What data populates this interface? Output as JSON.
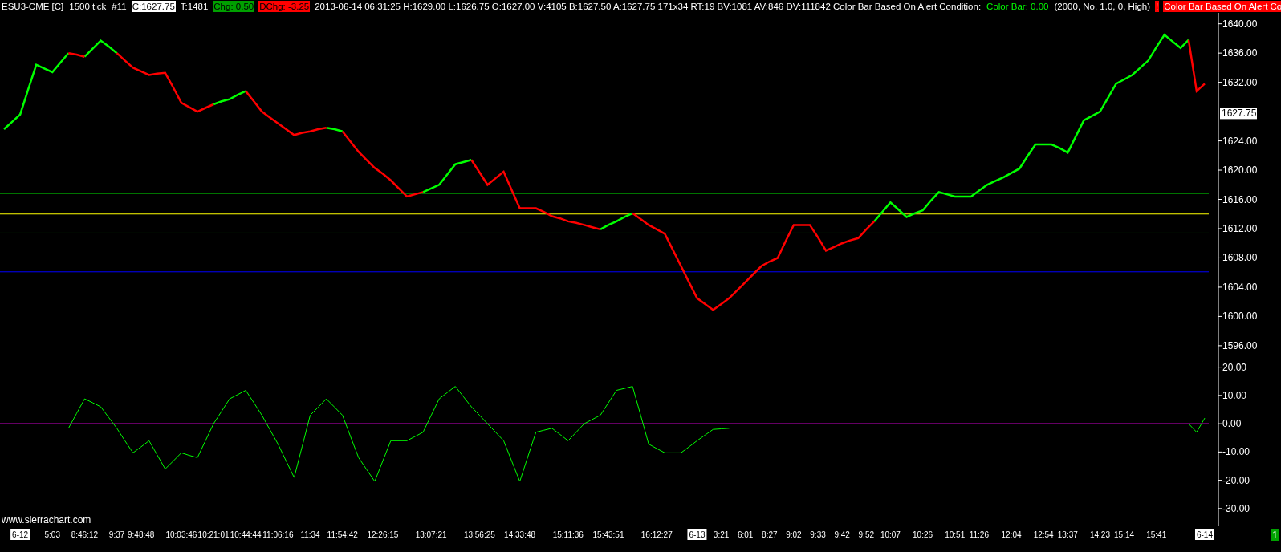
{
  "header": [
    {
      "kind": "plain",
      "text": "ESU3-CME [C]"
    },
    {
      "kind": "plain",
      "text": "1500 tick"
    },
    {
      "kind": "plain",
      "text": "#11"
    },
    {
      "kind": "inverse",
      "text": "C:1627.75"
    },
    {
      "kind": "plain",
      "text": "T:1481"
    },
    {
      "kind": "up",
      "text": "Chg: 0.50"
    },
    {
      "kind": "down",
      "text": "DChg: -3.25"
    },
    {
      "kind": "plain",
      "text": "2013-06-14 06:31:25 H:1629.00 L:1626.75 O:1627.00 V:4105 B:1627.50 A:1627.75 171x34 RT:19 BV:1081 AV:846 DV:111842 Color Bar Based On Alert Condition:"
    },
    {
      "kind": "green",
      "text": "Color Bar: 0.00"
    },
    {
      "kind": "plain",
      "text": "(2000, No, 1.0, 0, High)"
    },
    {
      "kind": "alert",
      "text": "!"
    },
    {
      "kind": "alert",
      "text": "Color Bar Based On Alert Co"
    }
  ],
  "price_chart": {
    "current_price": "1627.75",
    "chart_data": {
      "type": "line",
      "ylim": [
        1595,
        1641.5
      ],
      "categories": [
        null,
        null,
        null,
        null,
        null,
        null,
        null,
        null,
        null,
        null,
        null,
        null,
        null,
        null,
        null,
        null,
        null,
        null,
        null,
        null,
        null,
        null,
        null,
        null,
        null,
        null,
        null,
        null,
        null,
        null,
        null,
        null,
        null,
        null,
        null,
        null,
        null,
        null,
        null,
        null,
        null,
        null,
        null,
        null,
        null,
        null,
        null,
        null,
        null,
        null,
        null,
        null,
        null,
        null,
        null,
        null,
        null,
        null,
        null,
        null,
        null,
        null,
        null,
        null,
        null,
        null,
        null,
        null,
        null,
        null,
        null,
        null,
        null,
        null,
        null,
        null,
        null,
        null,
        null,
        null,
        null,
        null,
        null,
        null,
        null,
        null,
        null,
        null,
        null,
        null,
        null,
        null,
        null,
        null,
        null,
        null,
        null,
        null,
        null,
        null,
        null,
        null,
        null,
        null,
        null,
        null,
        null,
        null,
        null,
        null,
        null,
        null,
        null,
        null,
        null,
        null,
        null,
        null,
        null,
        null,
        null,
        null,
        null,
        null,
        null,
        null,
        null,
        null,
        null,
        null,
        null,
        null,
        null,
        null,
        null,
        null,
        null,
        null,
        null,
        null,
        null,
        null,
        null,
        null,
        null,
        null,
        null,
        null,
        null,
        null
      ],
      "yticks": [
        {
          "value": 1640,
          "label": "1640.00"
        },
        {
          "value": 1636,
          "label": "1636.00"
        },
        {
          "value": 1632,
          "label": "1632.00"
        },
        {
          "value": 1624,
          "label": "1624.00"
        },
        {
          "value": 1620,
          "label": "1620.00"
        },
        {
          "value": 1616,
          "label": "1616.00"
        },
        {
          "value": 1612,
          "label": "1612.00"
        },
        {
          "value": 1608,
          "label": "1608.00"
        },
        {
          "value": 1604,
          "label": "1604.00"
        },
        {
          "value": 1600,
          "label": "1600.00"
        },
        {
          "value": 1596,
          "label": "1596.00"
        }
      ],
      "series": [
        {
          "color": "#00ff00",
          "values": [
            1625.6,
            1626.6,
            1627.6,
            1631,
            1634.4,
            1633.9,
            1633.4,
            1634.7,
            1636,
            null,
            1635.5,
            1636.6,
            1637.7,
            1636.9,
            1636,
            null,
            null,
            null,
            null,
            null,
            null,
            null,
            null,
            null,
            null,
            null,
            1629,
            1629.4,
            1629.7,
            1630.3,
            1630.8,
            null,
            null,
            null,
            null,
            null,
            null,
            null,
            null,
            null,
            1625.8,
            1625.6,
            1625.3,
            null,
            null,
            null,
            null,
            null,
            null,
            null,
            null,
            null,
            1617,
            1617.5,
            1618,
            1619.4,
            1620.8,
            1621.1,
            1621.4,
            null,
            null,
            null,
            null,
            null,
            null,
            null,
            null,
            null,
            null,
            null,
            null,
            null,
            null,
            null,
            1611.9,
            1612.5,
            1613,
            1613.6,
            1614.1,
            null,
            null,
            null,
            null,
            null,
            null,
            null,
            null,
            null,
            null,
            null,
            null,
            null,
            null,
            null,
            null,
            null,
            null,
            null,
            null,
            null,
            null,
            null,
            null,
            null,
            null,
            null,
            null,
            null,
            1613,
            1614.3,
            1615.6,
            1614.6,
            1613.6,
            1614.1,
            1614.5,
            1615.8,
            1617,
            1616.7,
            1616.4,
            1616.4,
            1616.4,
            1617.2,
            1618,
            1618.5,
            1619,
            1619.6,
            1620.2,
            1621.9,
            1623.5,
            1623.5,
            1623.5,
            1623,
            1622.4,
            1624.6,
            1626.8,
            1627.4,
            1628,
            1629.9,
            1631.8,
            1632.4,
            1633,
            1634,
            1635,
            1636.8,
            1638.5,
            1637.6,
            1636.7,
            1637.8,
            null,
            null
          ]
        },
        {
          "color": "#ff0000",
          "values": [
            null,
            null,
            null,
            null,
            null,
            null,
            null,
            null,
            1636,
            1635.8,
            1635.5,
            null,
            null,
            null,
            1636,
            1635,
            1634,
            1633.5,
            1633,
            1633.2,
            1633.3,
            1631.3,
            1629.2,
            1628.6,
            1628,
            1628.5,
            1629,
            null,
            null,
            null,
            1630.8,
            1629.4,
            1628,
            1627.2,
            1626.4,
            1625.6,
            1624.8,
            1625.1,
            1625.3,
            1625.6,
            1625.8,
            null,
            1625.3,
            1623.9,
            1622.5,
            1621.4,
            1620.3,
            1619.5,
            1618.6,
            1617.5,
            1616.4,
            1616.7,
            1617,
            null,
            null,
            null,
            null,
            null,
            1621.4,
            1619.7,
            1618,
            1618.9,
            1619.8,
            1617.3,
            1614.8,
            1614.8,
            1614.8,
            1614.3,
            1613.7,
            1613.4,
            1613,
            1612.8,
            1612.5,
            1612.2,
            1611.9,
            null,
            null,
            null,
            1614.1,
            1613.3,
            1612.5,
            1611.9,
            1611.3,
            1609.1,
            1606.9,
            1604.7,
            1602.5,
            1601.7,
            1600.9,
            1601.7,
            1602.5,
            1603.6,
            1604.7,
            1605.8,
            1606.9,
            1607.5,
            1608,
            1610.3,
            1612.5,
            1612.5,
            1612.5,
            1610.8,
            1609,
            1609.5,
            1610,
            1610.4,
            1610.7,
            1611.9,
            1613,
            null,
            null,
            null,
            null,
            null,
            null,
            null,
            null,
            null,
            null,
            null,
            null,
            null,
            null,
            null,
            null,
            null,
            null,
            null,
            null,
            null,
            null,
            null,
            null,
            null,
            null,
            null,
            null,
            null,
            null,
            null,
            null,
            null,
            null,
            null,
            null,
            null,
            null,
            1637.8,
            1630.8,
            1631.8
          ]
        }
      ],
      "ref_lines": [
        {
          "axis": "y",
          "value": 1616.8,
          "color": "#00a000"
        },
        {
          "axis": "y",
          "value": 1614,
          "color": "#ffff00"
        },
        {
          "axis": "y",
          "value": 1611.4,
          "color": "#00a000"
        },
        {
          "axis": "y",
          "value": 1606.1,
          "color": "#0000ff"
        }
      ]
    }
  },
  "oscillator_chart": {
    "footer_text": "www.sierrachart.com",
    "chart_data": {
      "type": "line",
      "ylim": [
        -36,
        25
      ],
      "categories": [
        null,
        null,
        "6-12",
        null,
        null,
        null,
        "5:03",
        null,
        null,
        null,
        "8:46:12",
        null,
        null,
        null,
        "9:37",
        null,
        null,
        "9:48:48",
        null,
        null,
        null,
        null,
        "10:03:46",
        null,
        null,
        null,
        "10:21:01",
        null,
        null,
        null,
        "10:44:44",
        null,
        null,
        null,
        "11:06:16",
        null,
        null,
        null,
        "11:34",
        null,
        null,
        null,
        "11:54:42",
        null,
        null,
        null,
        null,
        "12:26:15",
        null,
        null,
        null,
        null,
        null,
        "13:07:21",
        null,
        null,
        null,
        null,
        null,
        "13:56:25",
        null,
        null,
        null,
        null,
        "14:33:48",
        null,
        null,
        null,
        null,
        null,
        "15:11:36",
        null,
        null,
        null,
        null,
        "15:43:51",
        null,
        null,
        null,
        null,
        null,
        "16:12:27",
        null,
        null,
        null,
        null,
        "6-13",
        null,
        null,
        "3:21",
        null,
        null,
        "6:01",
        null,
        null,
        "8:27",
        null,
        null,
        "9:02",
        null,
        null,
        "9:33",
        null,
        null,
        "9:42",
        null,
        null,
        "9:52",
        null,
        null,
        "10:07",
        null,
        null,
        null,
        "10:26",
        null,
        null,
        null,
        "10:51",
        null,
        null,
        "11:26",
        null,
        null,
        null,
        "12:04",
        null,
        null,
        null,
        "12:54",
        null,
        null,
        "13:37",
        null,
        null,
        null,
        "14:23",
        null,
        null,
        "15:14",
        null,
        null,
        null,
        "15:41",
        null,
        null,
        null,
        null,
        null,
        "6-14"
      ],
      "yticks": [
        {
          "value": 20,
          "label": "20.00"
        },
        {
          "value": 10,
          "label": "10.00"
        },
        {
          "value": 0,
          "label": "0.00"
        },
        {
          "value": -10,
          "label": "-10.00"
        },
        {
          "value": -20,
          "label": "-20.00"
        },
        {
          "value": -30,
          "label": "-30.00"
        }
      ],
      "series": [
        {
          "color": "#00ff00",
          "values": [
            null,
            null,
            null,
            null,
            null,
            null,
            null,
            null,
            -1.6,
            3.6,
            8.8,
            7.4,
            6,
            2.2,
            -1.6,
            -6,
            -10.3,
            -8.2,
            -6,
            -11,
            -16,
            -13.2,
            -10.3,
            -11.2,
            -12,
            -6,
            0,
            4.4,
            8.8,
            10.3,
            11.8,
            7.4,
            3,
            -2.1,
            -7.2,
            -13.1,
            -19,
            -8,
            3,
            5.9,
            8.8,
            5.9,
            3,
            -4.5,
            -12,
            -16.2,
            -20.4,
            -13.2,
            -6,
            -6,
            -6,
            -4.5,
            -3,
            2.9,
            8.8,
            11,
            13.2,
            9.6,
            6,
            3,
            0,
            -3,
            -6,
            -13.2,
            -20.4,
            -11.7,
            -3,
            -2.3,
            -1.6,
            -3.8,
            -6,
            -3,
            0,
            1.5,
            3,
            7.4,
            11.8,
            12.5,
            13.2,
            3,
            -7.2,
            -8.8,
            -10.3,
            -10.3,
            -10.3,
            -8.2,
            -6,
            -4,
            -2,
            -1.8,
            -1.6,
            null,
            null,
            null,
            null,
            null,
            null,
            null,
            null,
            null,
            null,
            null,
            null,
            null,
            null,
            null,
            null,
            null,
            null,
            null,
            null,
            null,
            null,
            null,
            null,
            null,
            null,
            null,
            null,
            null,
            null,
            null,
            null,
            null,
            null,
            null,
            null,
            null,
            null,
            null,
            null,
            null,
            null,
            null,
            null,
            null,
            null,
            null,
            null,
            null,
            null,
            null,
            null,
            null,
            null,
            null,
            null,
            0,
            -3,
            2
          ]
        }
      ],
      "ref_lines": [
        {
          "axis": "y",
          "value": 0,
          "color": "#ff00ff"
        }
      ]
    }
  },
  "status_badge": "1"
}
